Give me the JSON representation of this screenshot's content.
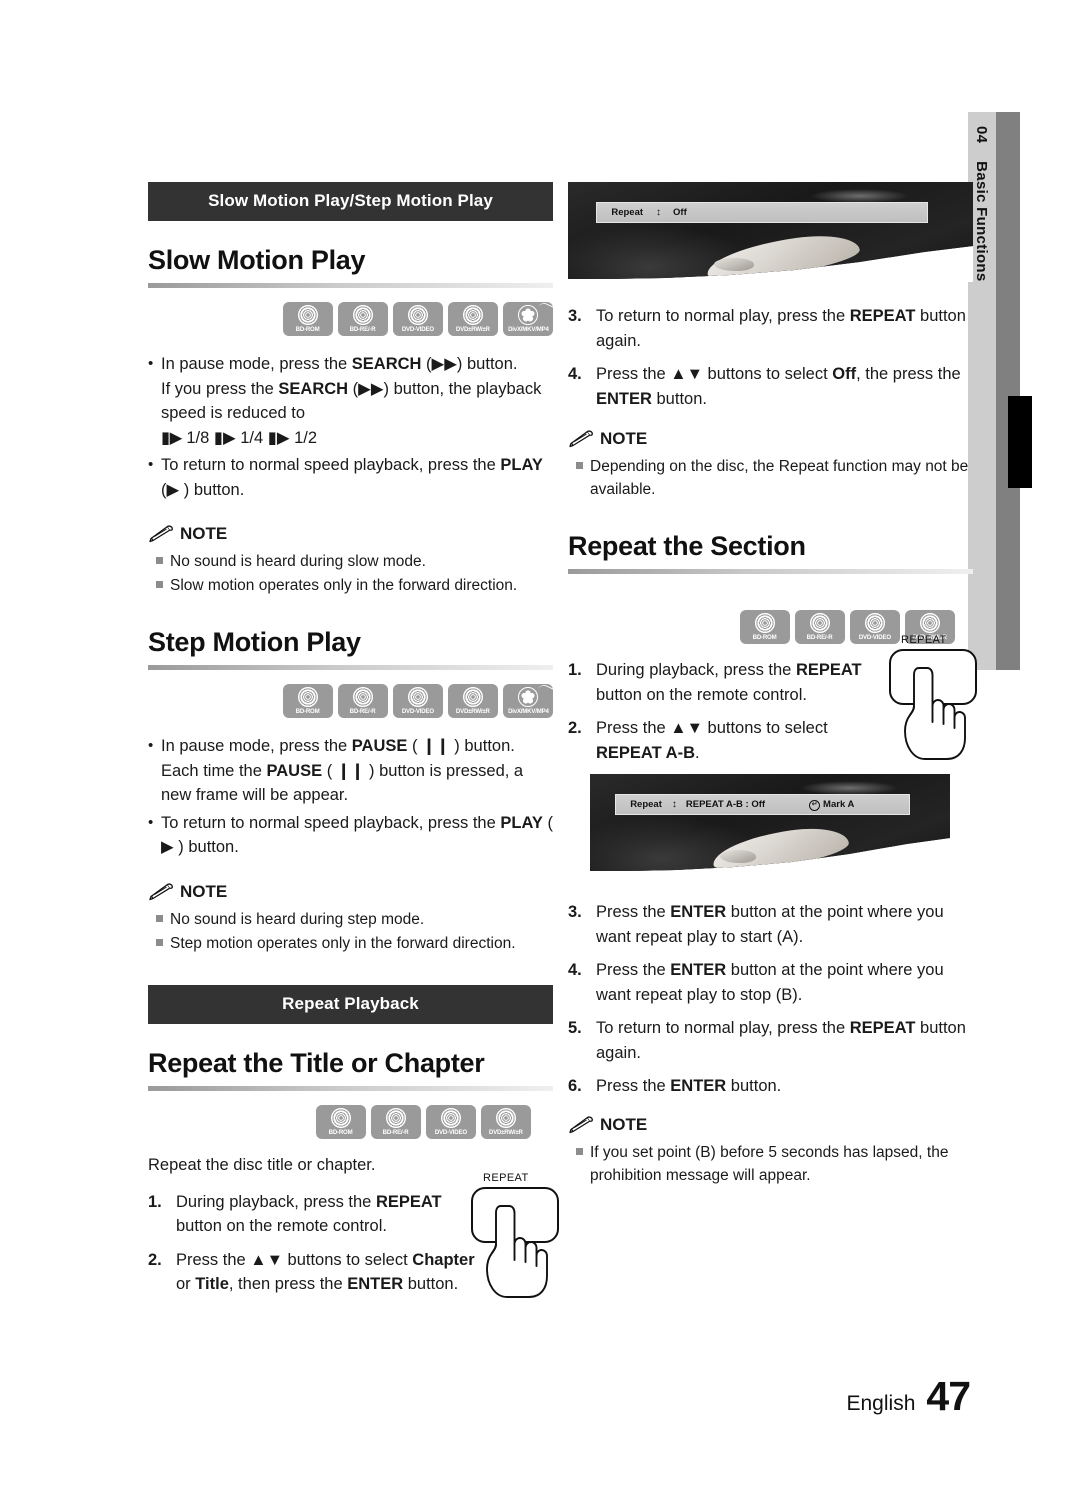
{
  "side_tab": {
    "number": "04",
    "label": "Basic Functions"
  },
  "footer": {
    "language": "English",
    "page": "47"
  },
  "left_column": {
    "section_bar": "Slow Motion Play/Step Motion Play",
    "slow_motion": {
      "heading": "Slow Motion Play",
      "discs": [
        "BD-ROM",
        "BD-RE/-R",
        "DVD-VIDEO",
        "DVD±RW/±R",
        "DivX/MKV/MP4"
      ],
      "bullet1_line1": "In pause mode, press the ",
      "bullet1_b1": "SEARCH",
      "bullet1_line1b": " (▶▶) button.",
      "bullet1_line2a": "If you press the ",
      "bullet1_b2": "SEARCH",
      "bullet1_line2b": " (▶▶) button, the playback speed is reduced to",
      "speeds": "1/8 ▮▶ 1/4 ▮▶ 1/2",
      "speeds_prefix": "▮▶",
      "bullet2a": "To return to normal speed playback, press the ",
      "bullet2_b": "PLAY",
      "bullet2b": " (▶ ) button.",
      "note_title": "NOTE",
      "notes": [
        "No sound is heard during slow mode.",
        "Slow motion operates only in the forward direction."
      ]
    },
    "step_motion": {
      "heading": "Step Motion Play",
      "discs": [
        "BD-ROM",
        "BD-RE/-R",
        "DVD-VIDEO",
        "DVD±RW/±R",
        "DivX/MKV/MP4"
      ],
      "bullet1a": "In pause mode, press the ",
      "bullet1_b1": "PAUSE",
      "bullet1b": " ( ❙❙ ) button. Each time the ",
      "bullet1_b2": "PAUSE",
      "bullet1c": " ( ❙❙ ) button is pressed, a new frame will be appear.",
      "bullet2a": "To return to normal speed playback, press the ",
      "bullet2_b": "PLAY",
      "bullet2b": " ( ▶ ) button.",
      "note_title": "NOTE",
      "notes": [
        "No sound is heard during step mode.",
        "Step motion operates only in the forward direction."
      ]
    },
    "repeat_playback_bar": "Repeat Playback",
    "repeat_title_chapter": {
      "heading": "Repeat the Title or Chapter",
      "discs": [
        "BD-ROM",
        "BD-RE/-R",
        "DVD-VIDEO",
        "DVD±RW/±R"
      ],
      "intro": "Repeat the disc title or chapter.",
      "step1_num": "1.",
      "step1a": "During playback, press the ",
      "step1_b": "REPEAT",
      "step1b": " button on the remote control.",
      "step2_num": "2.",
      "step2a": "Press the ▲▼ buttons to select ",
      "step2_b1": "Chapter",
      "step2b": " or ",
      "step2_b2": "Title",
      "step2c": ", then press the ",
      "step2_b3": "ENTER",
      "step2d": " button.",
      "remote_button_label": "REPEAT"
    }
  },
  "right_column": {
    "tv_shot_1": {
      "osd_label": "Repeat",
      "osd_updown": "↕",
      "osd_value": "Off"
    },
    "repeat_steps_continued": [
      {
        "num": "3.",
        "a": "To return to normal play, press the ",
        "b": "REPEAT",
        "c": " button again."
      },
      {
        "num": "4.",
        "a": "Press the ▲▼ buttons to select ",
        "b": "Off",
        "c": ", the press the ",
        "b2": "ENTER",
        "d": " button."
      }
    ],
    "note_1": {
      "title": "NOTE",
      "items": [
        "Depending on the disc, the Repeat function may not be available."
      ]
    },
    "repeat_section": {
      "heading": "Repeat the Section",
      "discs": [
        "BD-ROM",
        "BD-RE/-R",
        "DVD-VIDEO",
        "DVD±RW/±R"
      ],
      "step1_num": "1.",
      "step1a": "During playback, press the ",
      "step1_b": "REPEAT",
      "step1b": " button on the remote control.",
      "step2_num": "2.",
      "step2a": "Press the ▲▼ buttons to select ",
      "step2_b": "REPEAT A-B",
      "step2b": ".",
      "remote_button_label": "REPEAT"
    },
    "tv_shot_2": {
      "osd_label": "Repeat",
      "osd_updown": "↕",
      "osd_value": "REPEAT A-B : Off",
      "osd_enter_icon": "↵",
      "osd_mark": "Mark A"
    },
    "section_steps": [
      {
        "num": "3.",
        "a": "Press the ",
        "b": "ENTER",
        "c": " button at the point where you want repeat play to start (A)."
      },
      {
        "num": "4.",
        "a": "Press the ",
        "b": "ENTER",
        "c": " button at the point where you want repeat play to stop (B)."
      },
      {
        "num": "5.",
        "a": "To return to normal play, press the ",
        "b": "REPEAT",
        "c": " button again."
      },
      {
        "num": "6.",
        "a": "Press the ",
        "b": "ENTER",
        "c": " button."
      }
    ],
    "note_2": {
      "title": "NOTE",
      "items": [
        "If you set point (B) before 5 seconds has lapsed, the prohibition message will appear."
      ]
    }
  }
}
